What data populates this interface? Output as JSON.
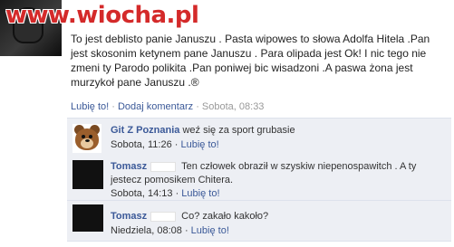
{
  "watermark": "www.wiocha.pl",
  "post": {
    "text": "To jest deblisto panie Januszu . Pasta wipowes to słowa Adolfa Hitela .Pan jest skosonim ketynem pane Januszu . Para olipada jest Ok! I nic tego nie zmeni ty Parodo polikita .Pan poniwej bic wisadzoni .A paswa żona jest murzykoł pane Januszu .®",
    "like_link": "Lubię to!",
    "comment_link": "Dodaj komentarz",
    "timestamp": "Sobota, 08:33",
    "separator": " · "
  },
  "comments": [
    {
      "author": "Git Z Poznania",
      "text": "weź się za sport grubasie",
      "timestamp": "Sobota, 11:26",
      "like_label": "Lubię to!",
      "avatar_icon": "pedobear-icon"
    },
    {
      "author": "Tomasz",
      "text": "Ten człowek obraził w szyskiw niepenospawitch . A ty jestecz pomosikem Chitera.",
      "timestamp": "Sobota, 14:13",
      "like_label": "Lubię to!"
    },
    {
      "author": "Tomasz",
      "text": "Co? zakało kakoło?",
      "timestamp": "Niedziela, 08:08",
      "like_label": "Lubię to!"
    }
  ],
  "colors": {
    "link": "#3b5998",
    "comment_bg": "#edeff4",
    "watermark": "#d42a2a"
  }
}
